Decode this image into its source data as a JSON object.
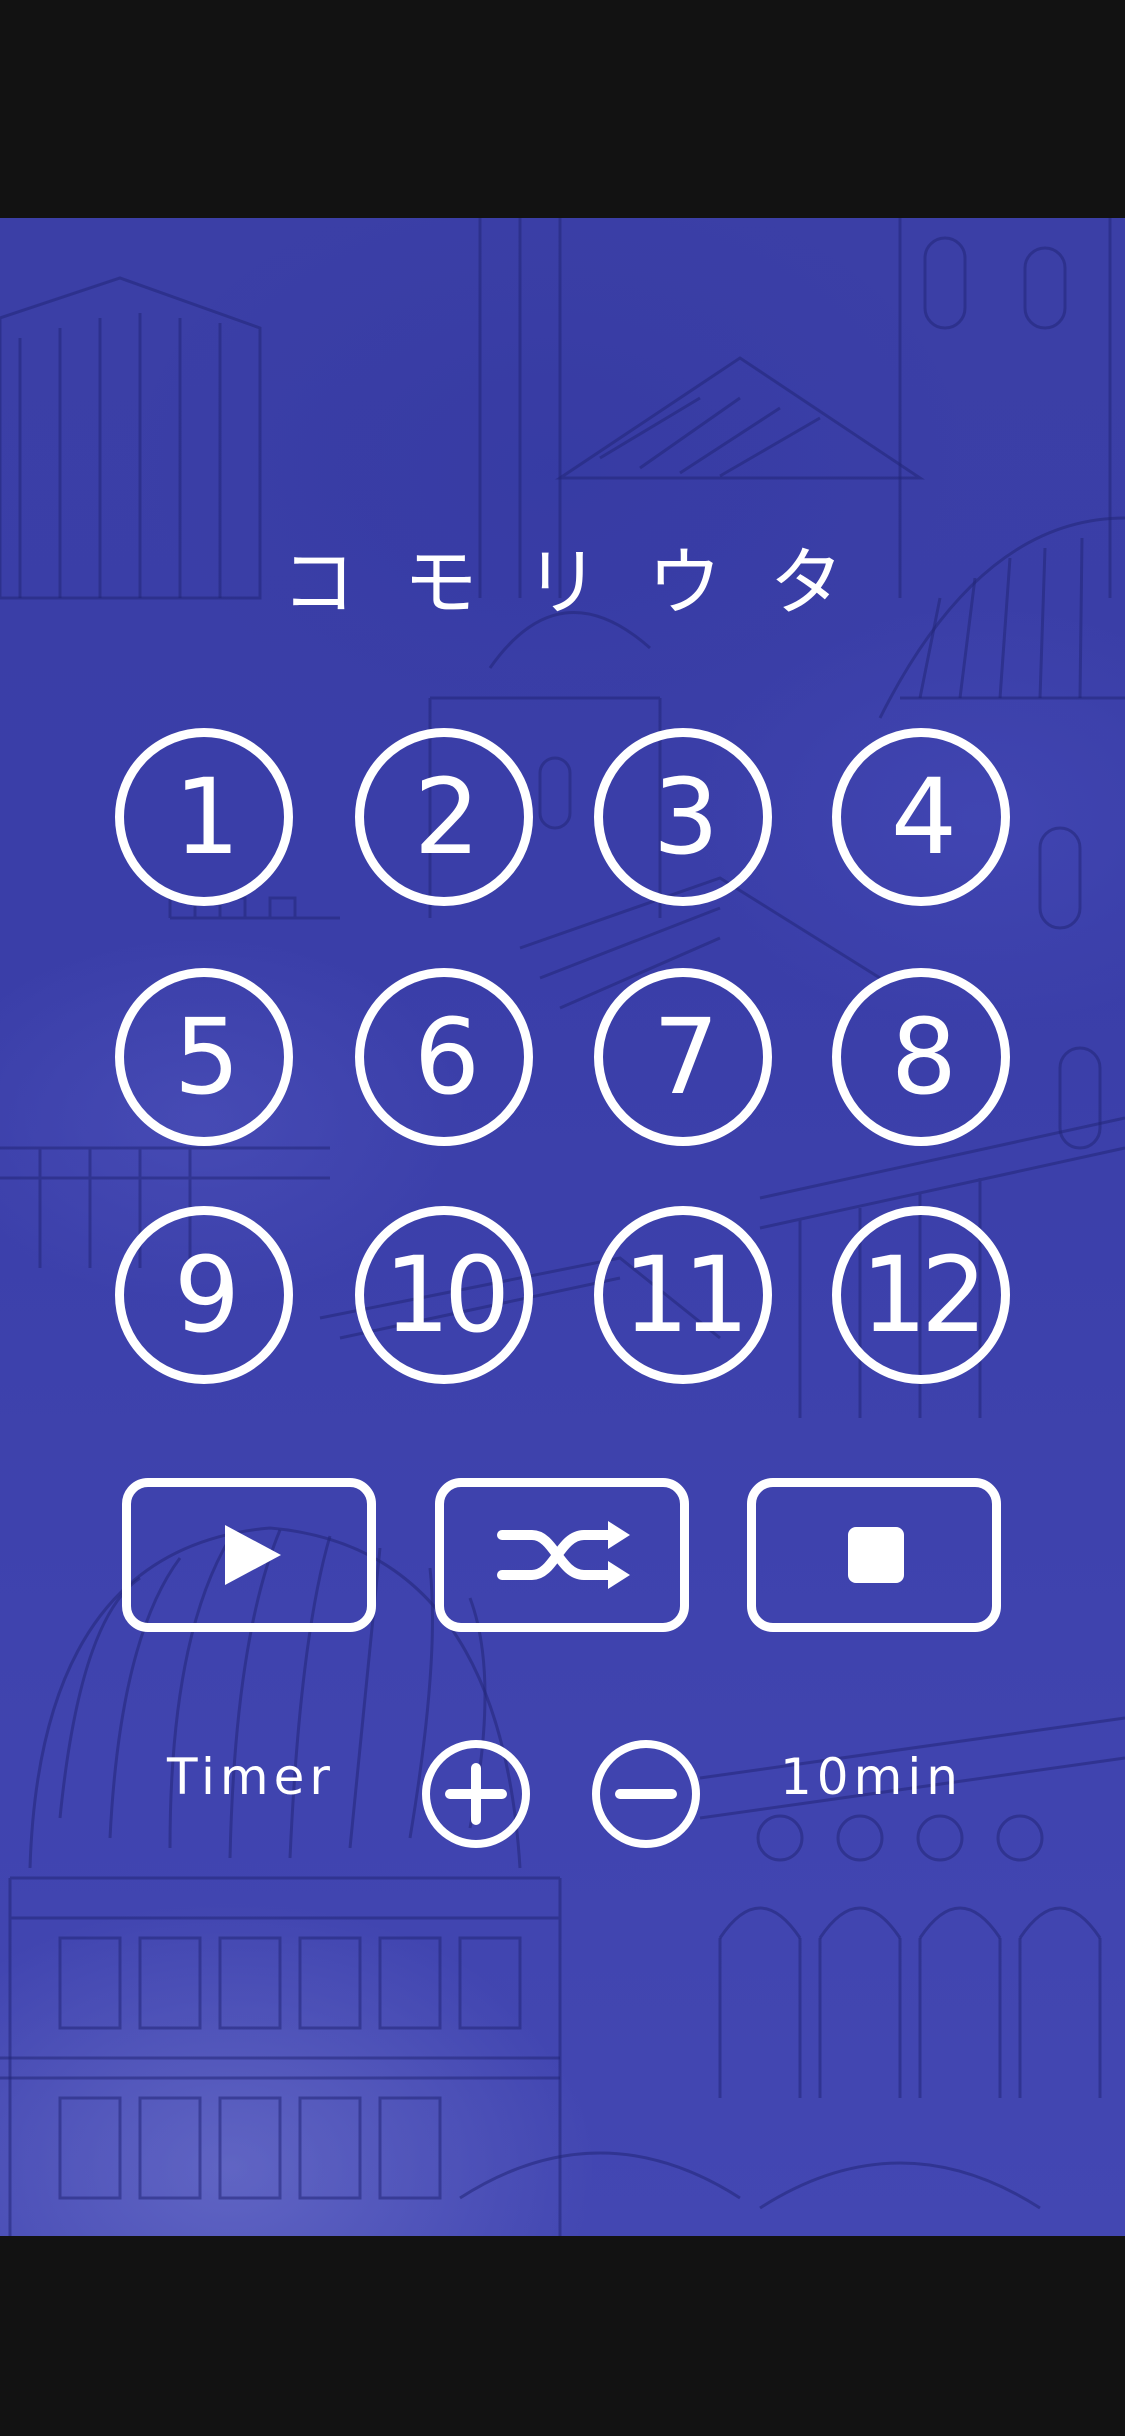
{
  "app": {
    "title": "コモリウタ"
  },
  "tracks": [
    "1",
    "2",
    "3",
    "4",
    "5",
    "6",
    "7",
    "8",
    "9",
    "10",
    "11",
    "12"
  ],
  "controls": {
    "play_icon": "play-icon",
    "shuffle_icon": "shuffle-icon",
    "stop_icon": "stop-icon"
  },
  "timer": {
    "label": "Timer",
    "value": "10min",
    "increase_icon": "plus-icon",
    "decrease_icon": "minus-icon"
  },
  "colors": {
    "background": "#3b3fa6",
    "foreground": "#ffffff",
    "letterbox": "#121212"
  }
}
